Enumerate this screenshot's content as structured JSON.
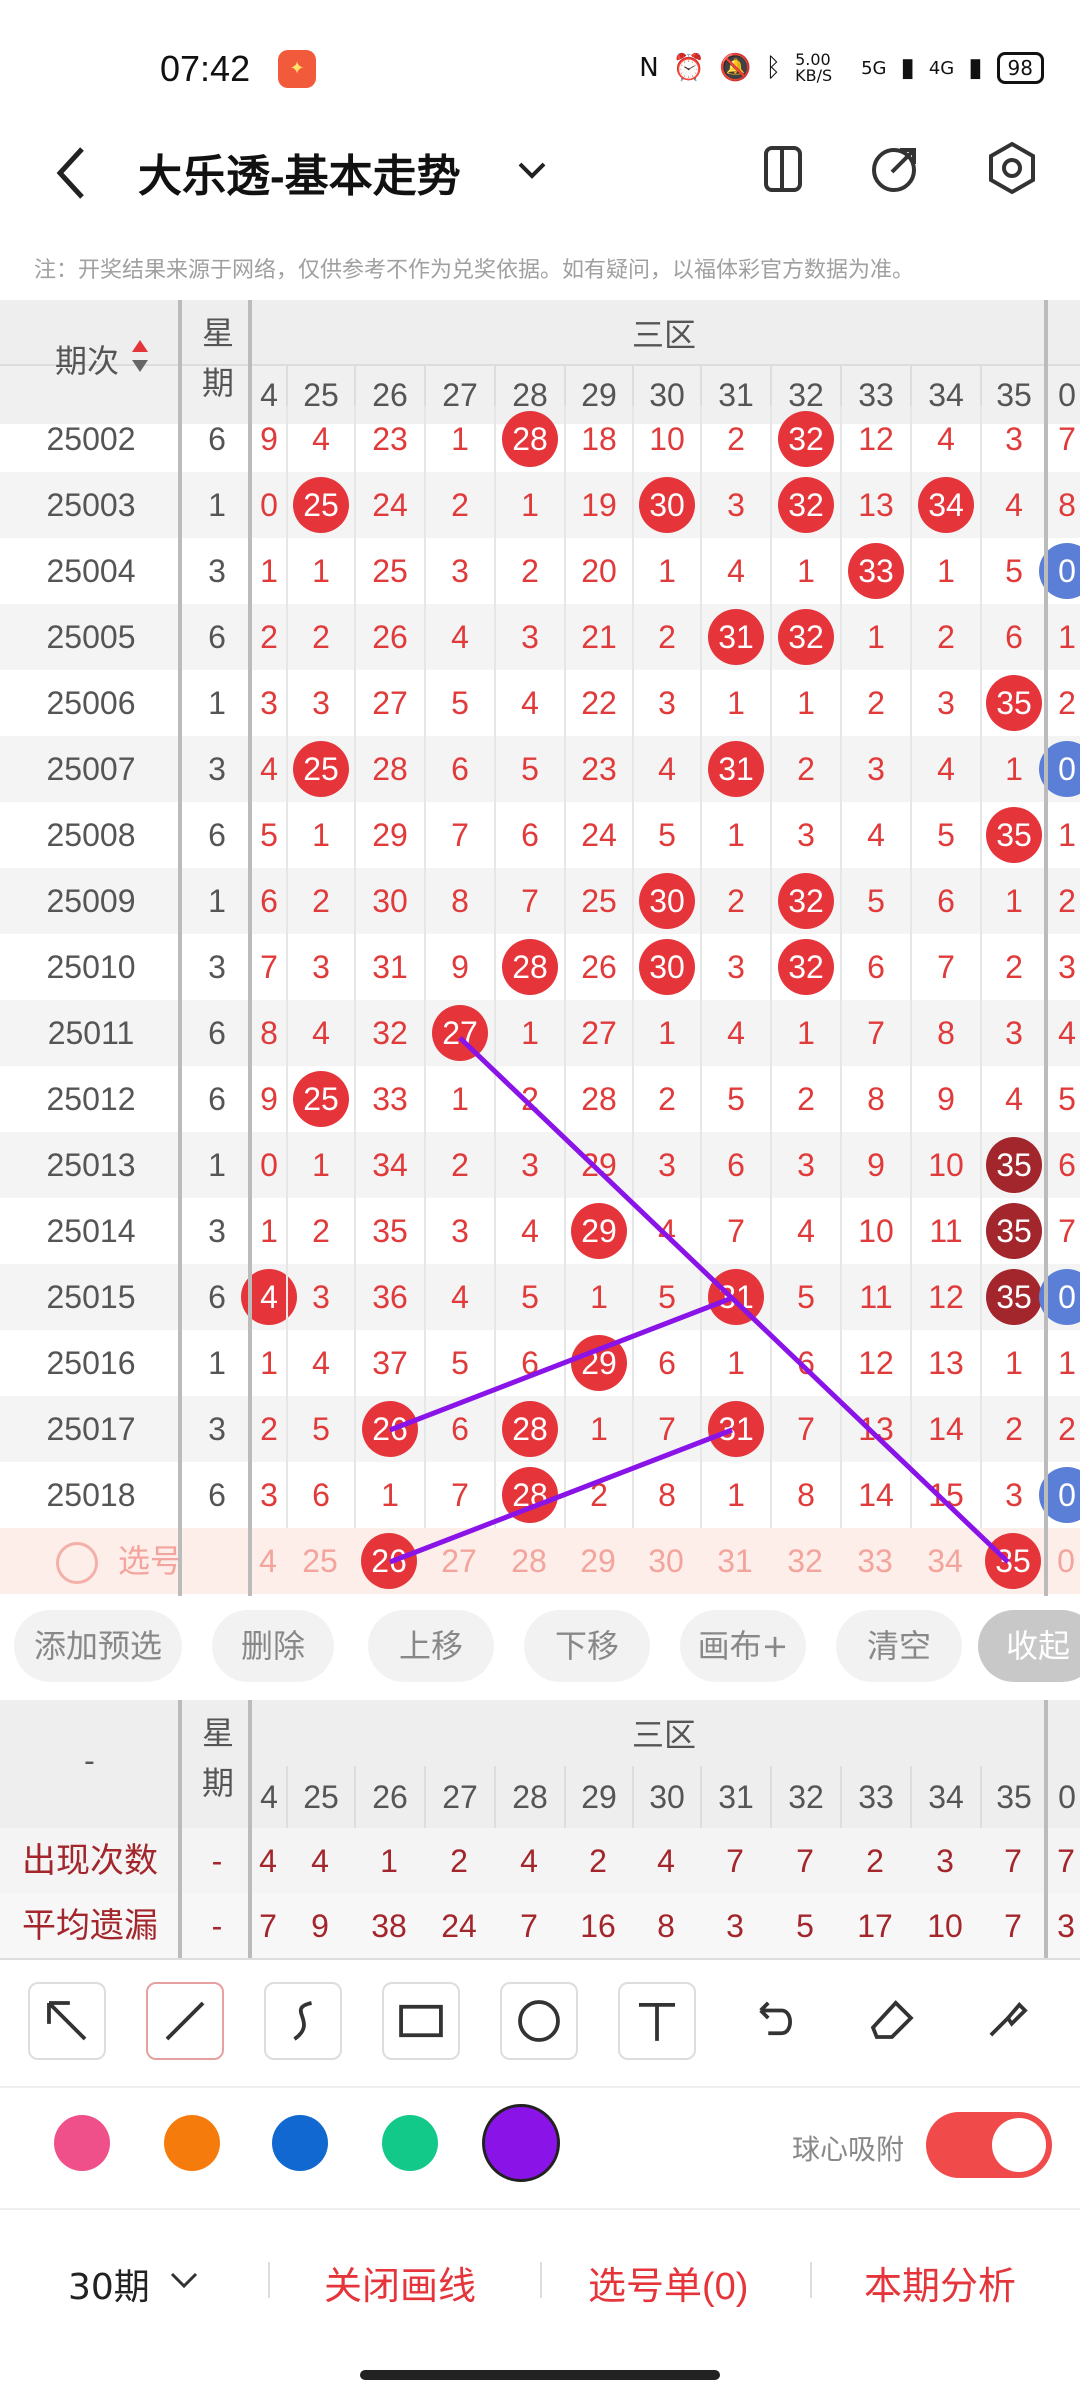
{
  "status_bar": {
    "time": "07:42",
    "speed": "5.00 KB/S",
    "signal1": "5G",
    "signal2": "4G",
    "battery": "98"
  },
  "header": {
    "title": "大乐透-基本走势"
  },
  "notice": "注：开奖结果来源于网络，仅供参考不作为兑奖依据。如有疑问，以福体彩官方数据为准。",
  "grid": {
    "col_period": "期次",
    "col_week": "星期",
    "section": "三区",
    "columns": [
      "4",
      "25",
      "26",
      "27",
      "28",
      "29",
      "30",
      "31",
      "32",
      "33",
      "34",
      "35",
      "0"
    ],
    "rows": [
      {
        "period": "25002",
        "week": "6",
        "cells": [
          "9",
          "4",
          "23",
          "1",
          "28",
          "18",
          "10",
          "2",
          "32",
          "12",
          "4",
          "3",
          "7"
        ],
        "hits": [
          4,
          8
        ]
      },
      {
        "period": "25003",
        "week": "1",
        "cells": [
          "0",
          "25",
          "24",
          "2",
          "1",
          "19",
          "30",
          "3",
          "32",
          "13",
          "34",
          "4",
          "8"
        ],
        "hits": [
          1,
          6,
          8,
          10
        ]
      },
      {
        "period": "25004",
        "week": "3",
        "cells": [
          "1",
          "1",
          "25",
          "3",
          "2",
          "20",
          "1",
          "4",
          "1",
          "33",
          "1",
          "5",
          "0"
        ],
        "hits": [
          9
        ],
        "blue": [
          12
        ]
      },
      {
        "period": "25005",
        "week": "6",
        "cells": [
          "2",
          "2",
          "26",
          "4",
          "3",
          "21",
          "2",
          "31",
          "32",
          "1",
          "2",
          "6",
          "1"
        ],
        "hits": [
          7,
          8
        ]
      },
      {
        "period": "25006",
        "week": "1",
        "cells": [
          "3",
          "3",
          "27",
          "5",
          "4",
          "22",
          "3",
          "1",
          "1",
          "2",
          "3",
          "35",
          "2"
        ],
        "hits": [
          11
        ]
      },
      {
        "period": "25007",
        "week": "3",
        "cells": [
          "4",
          "25",
          "28",
          "6",
          "5",
          "23",
          "4",
          "31",
          "2",
          "3",
          "4",
          "1",
          "0"
        ],
        "hits": [
          1,
          7
        ],
        "blue": [
          12
        ]
      },
      {
        "period": "25008",
        "week": "6",
        "cells": [
          "5",
          "1",
          "29",
          "7",
          "6",
          "24",
          "5",
          "1",
          "3",
          "4",
          "5",
          "35",
          "1"
        ],
        "hits": [
          11
        ]
      },
      {
        "period": "25009",
        "week": "1",
        "cells": [
          "6",
          "2",
          "30",
          "8",
          "7",
          "25",
          "30",
          "2",
          "32",
          "5",
          "6",
          "1",
          "2"
        ],
        "hits": [
          6,
          8
        ]
      },
      {
        "period": "25010",
        "week": "3",
        "cells": [
          "7",
          "3",
          "31",
          "9",
          "28",
          "26",
          "30",
          "3",
          "32",
          "6",
          "7",
          "2",
          "3"
        ],
        "hits": [
          4,
          6,
          8
        ]
      },
      {
        "period": "25011",
        "week": "6",
        "cells": [
          "8",
          "4",
          "32",
          "27",
          "1",
          "27",
          "1",
          "4",
          "1",
          "7",
          "8",
          "3",
          "4"
        ],
        "hits": [
          3
        ]
      },
      {
        "period": "25012",
        "week": "6",
        "cells": [
          "9",
          "25",
          "33",
          "1",
          "2",
          "28",
          "2",
          "5",
          "2",
          "8",
          "9",
          "4",
          "5"
        ],
        "hits": [
          1
        ]
      },
      {
        "period": "25013",
        "week": "1",
        "cells": [
          "0",
          "1",
          "34",
          "2",
          "3",
          "29",
          "3",
          "6",
          "3",
          "9",
          "10",
          "35",
          "6"
        ],
        "dark": [
          11
        ]
      },
      {
        "period": "25014",
        "week": "3",
        "cells": [
          "1",
          "2",
          "35",
          "3",
          "4",
          "29",
          "4",
          "7",
          "4",
          "10",
          "11",
          "35",
          "7"
        ],
        "hits": [
          5
        ],
        "dark": [
          11
        ]
      },
      {
        "period": "25015",
        "week": "6",
        "cells": [
          "4",
          "3",
          "36",
          "4",
          "5",
          "1",
          "5",
          "31",
          "5",
          "11",
          "12",
          "35",
          "0"
        ],
        "hits": [
          0,
          7
        ],
        "dark": [
          11
        ],
        "blue": [
          12
        ]
      },
      {
        "period": "25016",
        "week": "1",
        "cells": [
          "1",
          "4",
          "37",
          "5",
          "6",
          "29",
          "6",
          "1",
          "6",
          "12",
          "13",
          "1",
          "1"
        ],
        "hits": [
          5
        ]
      },
      {
        "period": "25017",
        "week": "3",
        "cells": [
          "2",
          "5",
          "26",
          "6",
          "28",
          "1",
          "7",
          "31",
          "7",
          "13",
          "14",
          "2",
          "2"
        ],
        "hits": [
          2,
          4,
          7
        ]
      },
      {
        "period": "25018",
        "week": "6",
        "cells": [
          "3",
          "6",
          "1",
          "7",
          "28",
          "2",
          "8",
          "1",
          "8",
          "14",
          "15",
          "3",
          "0"
        ],
        "hits": [
          4
        ],
        "blue": [
          12
        ]
      }
    ],
    "select_row": {
      "label": "选号",
      "cells": [
        "4",
        "25",
        "26",
        "27",
        "28",
        "29",
        "30",
        "31",
        "32",
        "33",
        "34",
        "35",
        "0"
      ],
      "hits": [
        2,
        11
      ]
    }
  },
  "toolbar": [
    "添加预选",
    "删除",
    "上移",
    "下移",
    "画布+",
    "清空",
    "收起"
  ],
  "stats": {
    "dash": "-",
    "week": "星期",
    "section": "三区",
    "columns": [
      "4",
      "25",
      "26",
      "27",
      "28",
      "29",
      "30",
      "31",
      "32",
      "33",
      "34",
      "35",
      "0"
    ],
    "rows": [
      {
        "label": "出现次数",
        "week": "-",
        "cells": [
          "4",
          "4",
          "1",
          "2",
          "4",
          "2",
          "4",
          "7",
          "7",
          "2",
          "3",
          "7",
          "7"
        ]
      },
      {
        "label": "平均遗漏",
        "week": "-",
        "cells": [
          "7",
          "9",
          "38",
          "24",
          "7",
          "16",
          "8",
          "3",
          "5",
          "17",
          "10",
          "7",
          "3"
        ]
      }
    ]
  },
  "draw_tools": [
    "arrow-icon",
    "line-icon",
    "curve-icon",
    "rectangle-icon",
    "circle-icon",
    "text-icon",
    "undo-icon",
    "eraser-icon",
    "brush-icon"
  ],
  "colors": [
    "#f0508a",
    "#f57c0c",
    "#1068d0",
    "#12c98a",
    "#8a13e8"
  ],
  "snap": {
    "label": "球心吸附",
    "on": true
  },
  "bottom": {
    "periods": "30期",
    "close_draw": "关闭画线",
    "select_list": "选号单(0)",
    "analysis": "本期分析"
  }
}
